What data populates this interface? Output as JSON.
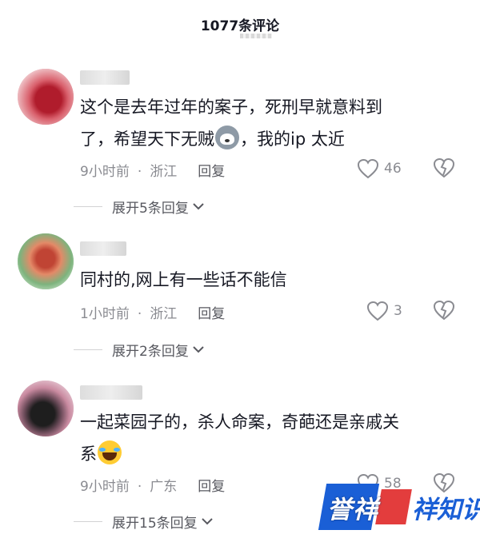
{
  "header": {
    "title": "1077条评论"
  },
  "comments": [
    {
      "text_line1": "这个是去年过年的案子，死刑早就意料到",
      "text_line2a": "了，希望天下无贼",
      "emoji": "husky-emoji",
      "text_line2b": "，我的ip 太近",
      "time": "9小时前",
      "dot": "·",
      "location": "浙江",
      "reply_label": "回复",
      "likes": "46",
      "expand_label": "展开5条回复",
      "avatar_colors": [
        "#c43a4a",
        "#d9707a",
        "#e4a2a8",
        "#b02030",
        "#f0c8cc"
      ]
    },
    {
      "text_line1": "同村的,网上有一些话不能信",
      "time": "1小时前",
      "dot": "·",
      "location": "浙江",
      "reply_label": "回复",
      "likes": "3",
      "expand_label": "展开2条回复",
      "avatar_colors": [
        "#6aa86a",
        "#d97a5a",
        "#9cc79c",
        "#c24a3a",
        "#e8c0a8"
      ]
    },
    {
      "text_line1": "一起菜园子的，杀人命案，奇葩还是亲戚关",
      "text_line2a": "系",
      "emoji": "laughing-crying-emoji",
      "time": "9小时前",
      "dot": "·",
      "location": "广东",
      "reply_label": "回复",
      "likes": "58",
      "expand_label": "展开15条回复",
      "avatar_colors": [
        "#2a2a2a",
        "#c98aa0",
        "#e6c7d3",
        "#5a5a5a",
        "#b46a86"
      ]
    }
  ],
  "watermark": {
    "part1": "誉祥",
    "part2": "祥知识"
  },
  "icons": {
    "like": "heart-outline-icon",
    "dislike": "broken-heart-icon",
    "expand": "chevron-down-icon"
  }
}
